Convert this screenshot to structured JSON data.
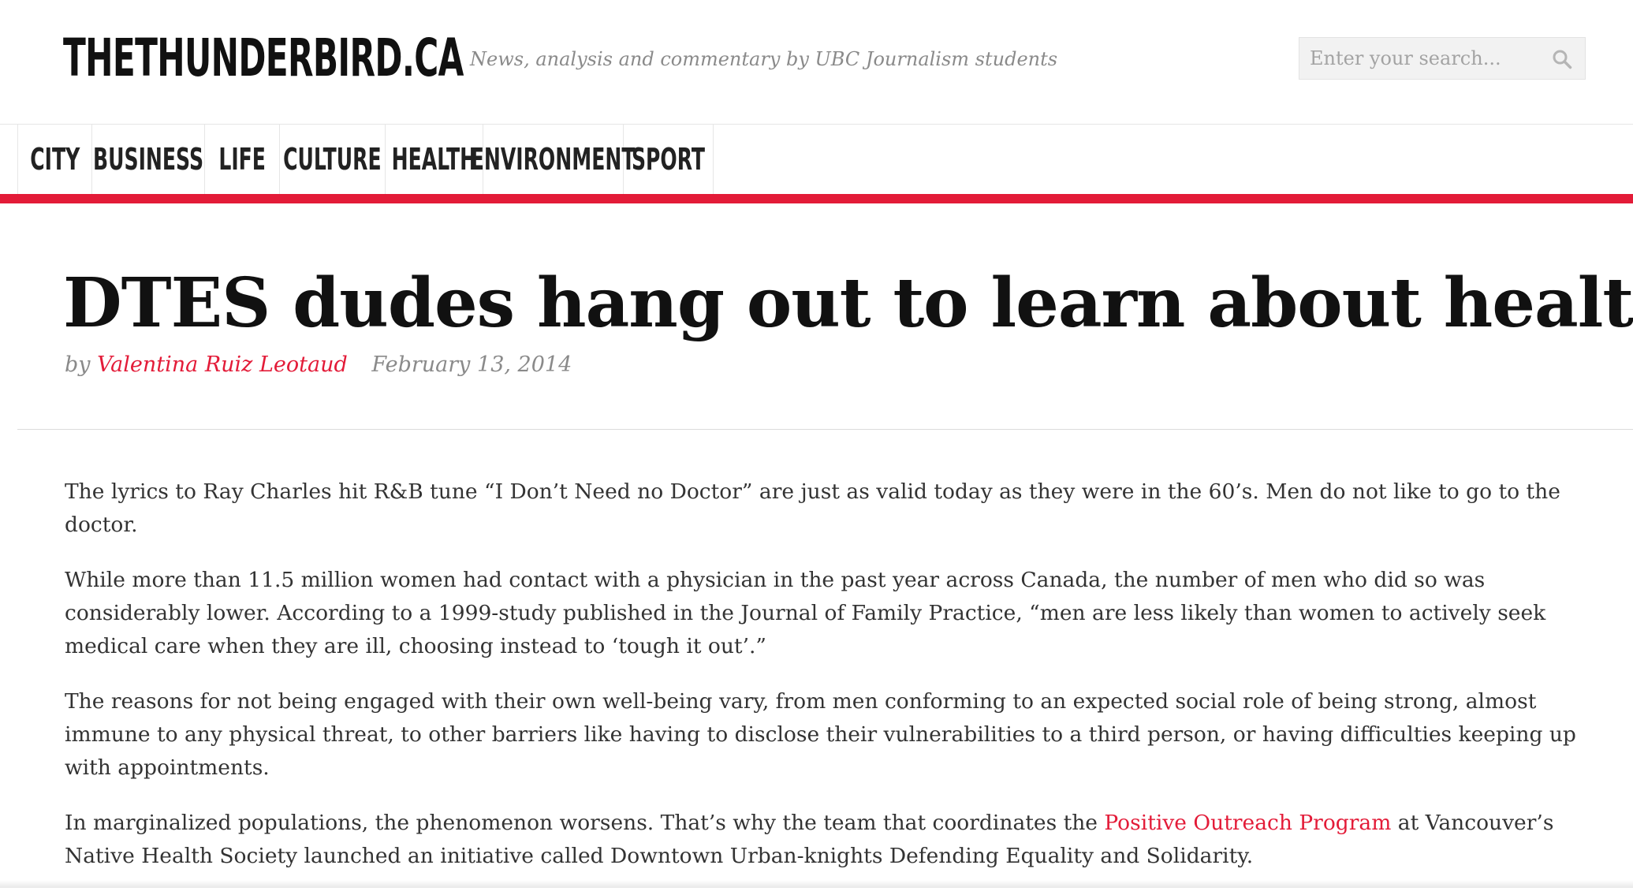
{
  "header": {
    "logo": "THETHUNDERBIRD.CA",
    "tagline": "News, analysis and commentary by UBC Journalism students",
    "search_placeholder": "Enter your search..."
  },
  "nav": {
    "items": [
      {
        "label": "CITY"
      },
      {
        "label": "BUSINESS"
      },
      {
        "label": "LIFE"
      },
      {
        "label": "CULTURE"
      },
      {
        "label": "HEALTH"
      },
      {
        "label": "ENVIRONMENT"
      },
      {
        "label": "SPORT"
      }
    ]
  },
  "article": {
    "title": "DTES dudes hang out to learn about health",
    "by": "by",
    "author": "Valentina Ruiz Leotaud",
    "date": "February 13, 2014",
    "p1": "The lyrics to Ray Charles hit R&B tune “I Don’t Need no Doctor” are just as valid today as they were in the 60’s. Men do not like to go to the doctor.",
    "p2": "While more than 11.5 million women had contact with a physician in the past year across Canada, the number of men who did so was considerably lower. According to a 1999-study published in the Journal of Family Practice, “men are less likely than women to actively seek medical care when they are ill, choosing instead to ‘tough it out’.”",
    "p3": "The reasons for not being engaged with their own well-being vary, from men conforming to an expected social role of being strong, almost immune to any physical threat, to other barriers like having to disclose their vulnerabilities to a third person, or having difficulties keeping up with appointments.",
    "p4_before": "In marginalized populations, the phenomenon worsens. That’s why the team that coordinates the ",
    "p4_link": "Positive Outreach Program",
    "p4_after": " at Vancouver’s Native Health Society launched an initiative called Downtown Urban-knights Defending Equality and Solidarity."
  },
  "colors": {
    "accent": "#e31b38",
    "muted": "#8a8a8a",
    "text": "#333333"
  },
  "icons": {
    "search": "search-icon"
  }
}
